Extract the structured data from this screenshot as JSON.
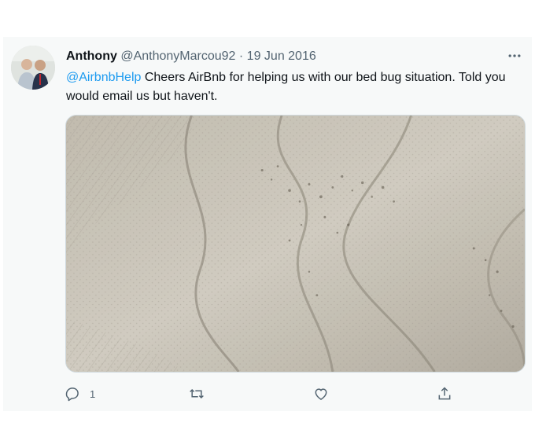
{
  "tweet": {
    "display_name": "Anthony",
    "handle": "@AnthonyMarcou92",
    "separator": "·",
    "date": "19 Jun 2016",
    "mention": "@AirbnbHelp",
    "body": " Cheers AirBnb for helping us with our bed bug situation. Told you would email us but haven't.",
    "reply_count": "1",
    "icons": {
      "more": "more-horizontal-icon",
      "reply": "reply-icon",
      "retweet": "retweet-icon",
      "like": "heart-icon",
      "share": "share-icon"
    }
  },
  "colors": {
    "link": "#1d9bf0",
    "secondary_text": "#536471",
    "card_background": "#f7f9f9"
  }
}
